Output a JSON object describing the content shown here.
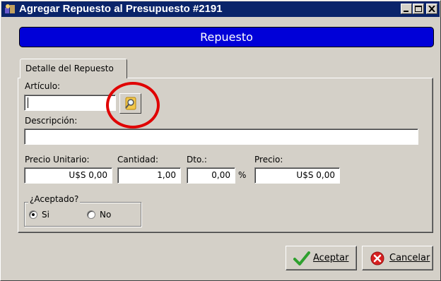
{
  "window": {
    "title": "Agregar Repuesto al Presupuesto #2191"
  },
  "banner": {
    "text": "Repuesto"
  },
  "tabs": [
    {
      "label": "Detalle del Repuesto"
    }
  ],
  "form": {
    "articulo": {
      "label": "Artículo:",
      "value": ""
    },
    "descripcion": {
      "label": "Descripción:",
      "value": ""
    },
    "precio_unitario": {
      "label": "Precio Unitario:",
      "value": "U$S 0,00"
    },
    "cantidad": {
      "label": "Cantidad:",
      "value": "1,00"
    },
    "descuento": {
      "label": "Dto.:",
      "value": "0,00",
      "unit": "%"
    },
    "precio": {
      "label": "Precio:",
      "value": "U$S 0,00"
    }
  },
  "aceptado": {
    "title": "¿Aceptado?",
    "options": [
      {
        "label": "Si",
        "selected": true
      },
      {
        "label": "No",
        "selected": false
      }
    ]
  },
  "buttons": {
    "accept": "Aceptar",
    "cancel": "Cancelar"
  },
  "icons": {
    "browse": "search-magnifier-icon",
    "accept": "green-check-icon",
    "cancel": "red-x-circle-icon",
    "app": "app-icon"
  },
  "colors": {
    "titlebar": "#0a246a",
    "banner": "#0000d8",
    "highlight": "#e00000",
    "accept_check": "#2ea02e",
    "cancel_circle": "#d82020"
  }
}
